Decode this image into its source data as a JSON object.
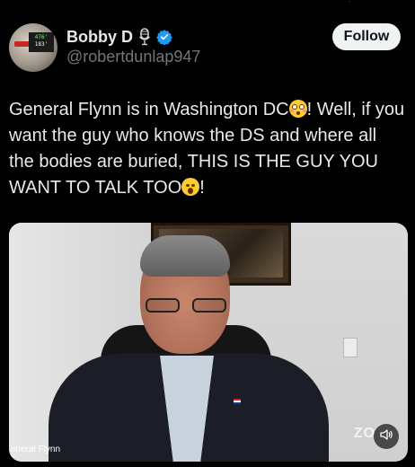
{
  "author": {
    "display_name": "Bobby D",
    "handle": "@robertdunlap947",
    "avatar_sign_line1": "476'",
    "avatar_sign_line2": "183'"
  },
  "follow_button": {
    "label": "Follow"
  },
  "tweet": {
    "part1": "General Flynn is in Washington DC",
    "part2": "! Well, if you want the guy who knows the DS and where all the bodies are buried, THIS IS THE GUY YOU WANT TO TALK TOO",
    "part3": "!"
  },
  "video": {
    "caption": "eneral Flynn",
    "watermark": "ZO"
  },
  "icons": {
    "mic": "microphone-icon",
    "verified": "verified-badge-icon",
    "emoji1": "flushed-face-emoji",
    "emoji2": "hushed-face-emoji",
    "sound": "speaker-sound-icon"
  },
  "colors": {
    "background": "#000000",
    "text": "#e7e9ea",
    "secondary_text": "#71767b",
    "verified_blue": "#1d9bf0",
    "follow_bg": "#eff3f4"
  }
}
